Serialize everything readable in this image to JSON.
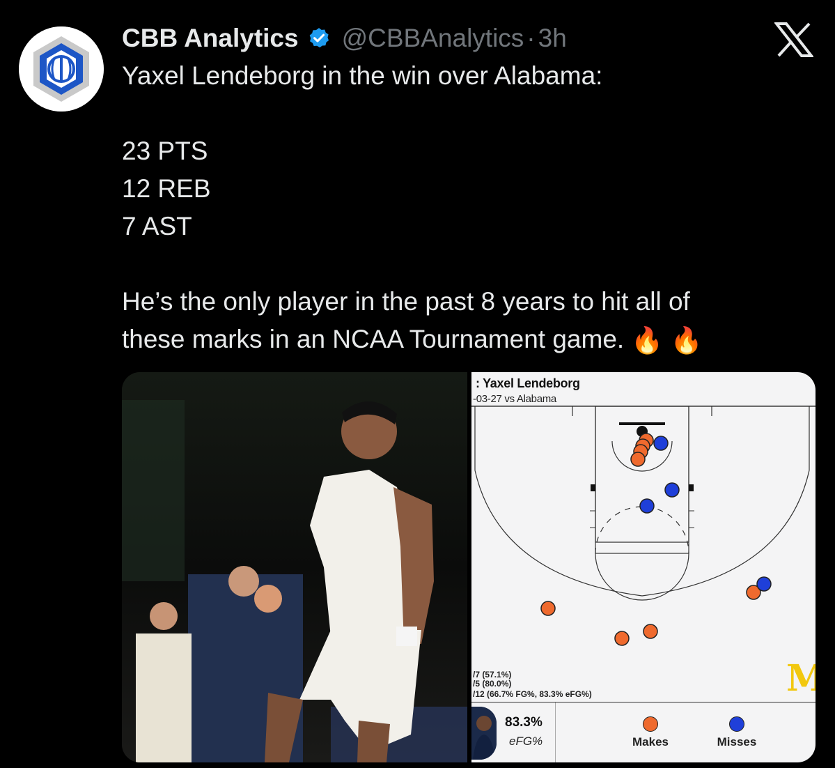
{
  "account": {
    "name": "CBB Analytics",
    "handle": "@CBBAnalytics",
    "separator": "·",
    "time": "3h"
  },
  "tweet": {
    "line1": "Yaxel Lendeborg in the win over Alabama:",
    "stat1": "23 PTS",
    "stat2": "12 REB",
    "stat3": "7 AST",
    "line2": "He’s the only player in the past 8 years to hit all of",
    "line3": "these marks in an NCAA Tournament game.",
    "emoji": "🔥 🔥"
  },
  "shot_chart": {
    "title": "Yaxel Lendeborg",
    "subtitle": "-03-27 vs Alabama",
    "prefix": ":",
    "stat_lines": [
      "/7 (57.1%)",
      "/5 (80.0%)",
      "/12 (66.7% FG%, 83.3% eFG%)"
    ],
    "efg_value": "83.3%",
    "efg_label": "eFG%",
    "legend_makes": "Makes",
    "legend_misses": "Misses",
    "logo_letter": "M",
    "colors": {
      "make": "#ef6a2e",
      "miss": "#1f3fd9",
      "accent": "#f2c80f"
    }
  },
  "colors": {
    "background": "#000000",
    "text": "#e7e9ea",
    "muted": "#71767b",
    "verified": "#1d9bf0"
  },
  "icons": {
    "verified": "verified-badge-icon",
    "platform": "x-logo-icon",
    "avatar": "cbb-analytics-logo"
  }
}
